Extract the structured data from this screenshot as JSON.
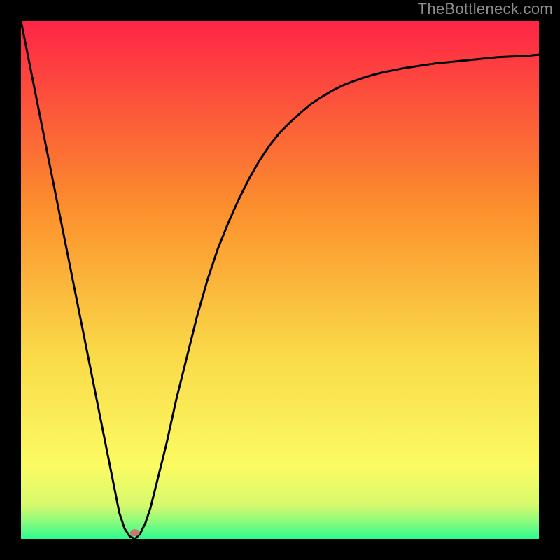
{
  "watermark": "TheBottleneck.com",
  "colors": {
    "gradient_top": "#fd2546",
    "gradient_mid_upper": "#fc8f2d",
    "gradient_mid": "#fad948",
    "gradient_mid_lower": "#fbfb63",
    "gradient_band": "#d6f96d",
    "gradient_bottom": "#2cfc8f",
    "line": "#000000",
    "frame": "#000000",
    "marker": "#c5796f"
  },
  "chart_data": {
    "type": "line",
    "title": "",
    "xlabel": "",
    "ylabel": "",
    "xlim": [
      0,
      100
    ],
    "ylim": [
      0,
      100
    ],
    "grid": false,
    "legend": false,
    "x": [
      0,
      2,
      4,
      6,
      8,
      10,
      12,
      14,
      16,
      18,
      19,
      20,
      21,
      22,
      23,
      24,
      25,
      26,
      28,
      30,
      32,
      34,
      36,
      38,
      40,
      42,
      44,
      46,
      48,
      50,
      52,
      54,
      56,
      58,
      60,
      62,
      64,
      66,
      68,
      70,
      72,
      74,
      76,
      78,
      80,
      82,
      84,
      86,
      88,
      90,
      92,
      94,
      96,
      98,
      100
    ],
    "y": [
      100,
      90,
      80,
      70,
      60,
      50,
      40,
      30,
      20,
      10,
      5,
      2,
      0.5,
      0,
      1,
      3,
      6,
      10,
      18,
      27,
      35,
      43,
      50,
      56,
      61,
      65.5,
      69.5,
      73,
      76,
      78.5,
      80.5,
      82.3,
      84,
      85.3,
      86.5,
      87.5,
      88.3,
      89,
      89.6,
      90.1,
      90.5,
      90.9,
      91.2,
      91.5,
      91.8,
      92,
      92.2,
      92.4,
      92.6,
      92.8,
      93,
      93.1,
      93.2,
      93.3,
      93.5
    ],
    "marker": {
      "x": 22,
      "y": 1.2,
      "rx": 7,
      "ry": 5
    }
  }
}
